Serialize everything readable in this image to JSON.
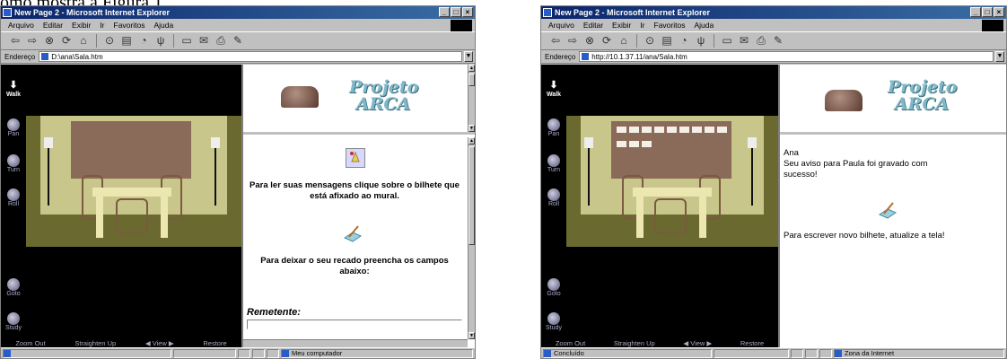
{
  "caption": "omo mostra a Figura 1.",
  "browser": {
    "menus": [
      "Arquivo",
      "Editar",
      "Exibir",
      "Ir",
      "Favoritos",
      "Ajuda"
    ],
    "address_label": "Endereço"
  },
  "left": {
    "title": "New Page 2 - Microsoft Internet Explorer",
    "address": "D:\\ana\\Sala.htm",
    "status_zone": "Meu computador",
    "msg_read": "Para ler suas mensagens clique sobre o bilhete que está afixado ao mural.",
    "msg_leave": "Para deixar o seu recado preencha os campos abaixo:",
    "remetente_label": "Remetente:"
  },
  "right": {
    "title": "New Page 2 - Microsoft Internet Explorer",
    "address": "http://10.1.37.11/ana/Sala.htm",
    "status_text": "Concluído",
    "status_zone": "Zona da Internet",
    "msg_name": "Ana",
    "msg_saved": "Seu aviso para Paula foi gravado com sucesso!",
    "msg_new": "Para escrever novo bilhete, atualize a tela!"
  },
  "vrml": {
    "nav": [
      "Walk",
      "Pan",
      "Turn",
      "Roll",
      "Goto",
      "Study"
    ],
    "bottom": [
      "Zoom Out",
      "Straighten Up",
      "View",
      "Restore"
    ]
  },
  "banner": {
    "line1": "Projeto",
    "line2": "ARCA"
  },
  "colors": {
    "titlebar": "#0a246a",
    "chrome": "#c0c0c0",
    "board": "#8a6a58",
    "wall": "#c8c68a",
    "banner_text": "#7fb8c8"
  }
}
